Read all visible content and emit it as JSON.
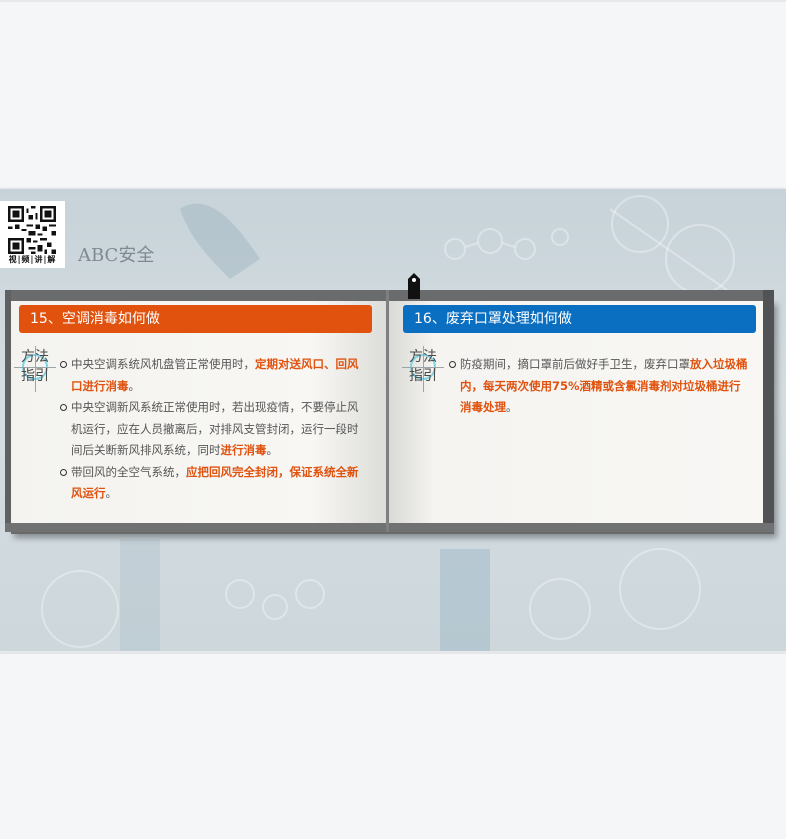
{
  "brand": {
    "name": "ABC安全",
    "qr_caption": "视|频|讲|解"
  },
  "cards": {
    "left": {
      "title": "15、空调消毒如何做",
      "guide_label": "方法指引",
      "accent": "#e0520e",
      "items": [
        {
          "text": "中央空调系统风机盘管正常使用时，",
          "highlight": "定期对送风口、回风口进行消毒",
          "tail": "。"
        },
        {
          "text": "中央空调新风系统正常使用时，若出现疫情，不要停止风机运行，应在人员撤离后，对排风支管封闭，运行一段时间后关断新风排风系统，同时",
          "highlight": "进行消毒",
          "tail": "。"
        },
        {
          "text": "带回风的全空气系统，",
          "highlight": "应把回风完全封闭，保证系统全新风运行",
          "tail": "。"
        }
      ]
    },
    "right": {
      "title": "16、废弃口罩处理如何做",
      "guide_label": "方法指引",
      "accent": "#0b6fc1",
      "items": [
        {
          "text": "防疫期间，摘口罩前后做好手卫生，废弃口罩",
          "highlight": "放入垃圾桶内，每天两次使用75%酒精或含氯消毒剂对垃圾桶进行消毒处理",
          "tail": "。"
        }
      ]
    }
  }
}
